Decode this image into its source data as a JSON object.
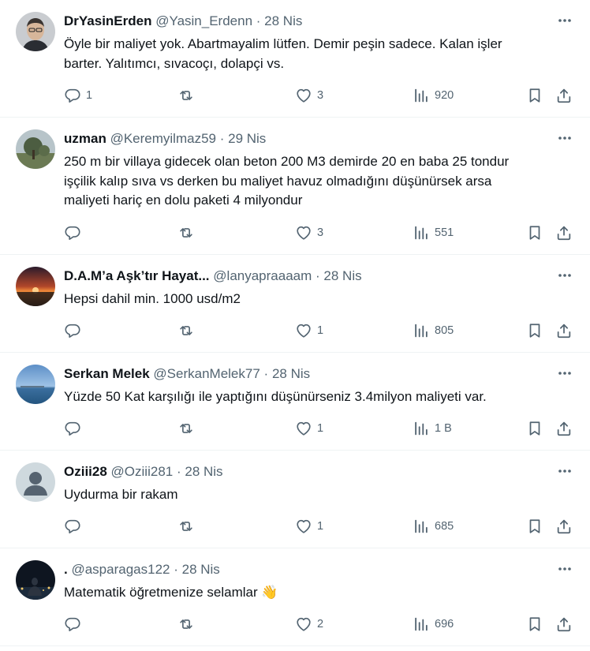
{
  "tweets": [
    {
      "name": "DrYasinErden",
      "handle": "@Yasin_Erdenn",
      "sep": "·",
      "date": "28 Nis",
      "lines": [
        "Öyle bir maliyet yok. Abartmayalim lütfen. Demir peşin sadece. Kalan işler",
        "barter. Yalıtımcı, sıvacoçı, dolapçi vs."
      ],
      "replies": "1",
      "retweets": "",
      "likes": "3",
      "views": "920",
      "avatar": "man-portrait"
    },
    {
      "name": "uzman",
      "handle": "@Keremyilmaz59",
      "sep": "·",
      "date": "29 Nis",
      "lines": [
        "250 m bir villaya gidecek olan beton 200 M3 demirde 20 en baba 25 tondur",
        "işçilik kalıp sıva vs derken bu maliyet havuz olmadığını düşünürsek arsa",
        "maliyeti hariç en dolu paketi 4 milyondur"
      ],
      "replies": "",
      "retweets": "",
      "likes": "3",
      "views": "551",
      "avatar": "tree-landscape"
    },
    {
      "name": "D.A.M’a Aşk’tır Hayat...",
      "handle": "@lanyapraaaam",
      "sep": "·",
      "date": "28 Nis",
      "lines": [
        "Hepsi dahil min. 1000 usd/m2"
      ],
      "replies": "",
      "retweets": "",
      "likes": "1",
      "views": "805",
      "avatar": "sunset"
    },
    {
      "name": "Serkan Melek",
      "handle": "@SerkanMelek77",
      "sep": "·",
      "date": "28 Nis",
      "lines": [
        "Yüzde 50 Kat karşılığı ile yaptığını düşünürseniz 3.4milyon maliyeti var."
      ],
      "replies": "",
      "retweets": "",
      "likes": "1",
      "views": "1 B",
      "avatar": "sea"
    },
    {
      "name": "Oziii28",
      "handle": "@Oziii281",
      "sep": "·",
      "date": "28 Nis",
      "lines": [
        "Uydurma bir rakam"
      ],
      "replies": "",
      "retweets": "",
      "likes": "1",
      "views": "685",
      "avatar": "default-profile"
    },
    {
      "name": ".",
      "handle": "@asparagas122",
      "sep": "·",
      "date": "28 Nis",
      "lines": [
        "Matematik öğretmenize selamlar 👋"
      ],
      "replies": "",
      "retweets": "",
      "likes": "2",
      "views": "696",
      "avatar": "night-figure"
    }
  ]
}
